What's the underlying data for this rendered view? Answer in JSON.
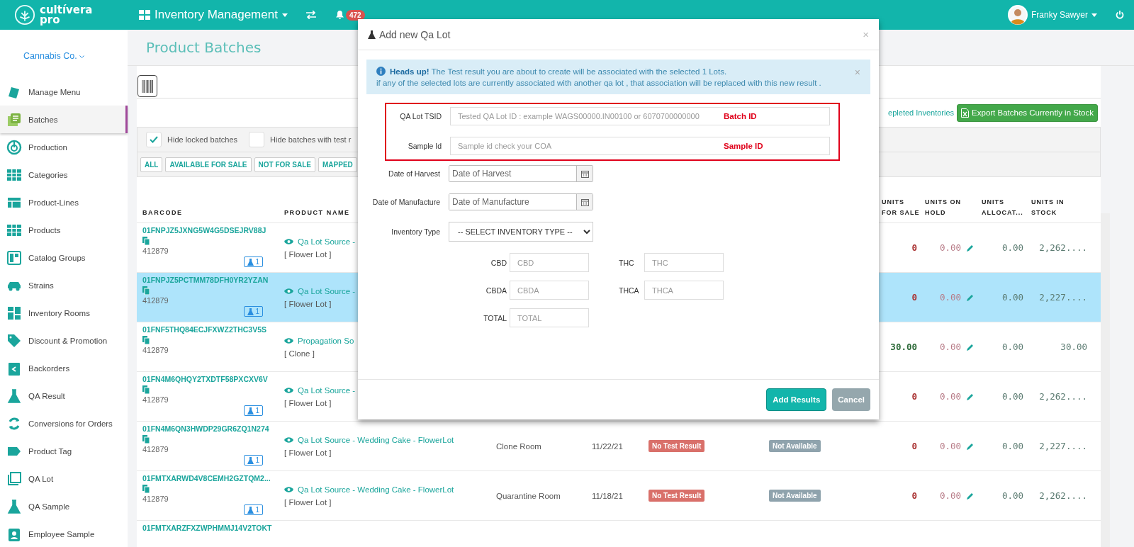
{
  "header": {
    "logo": {
      "line_1": "cultívera",
      "line_2": "pro"
    },
    "module": "Inventory Management",
    "notifications": "472",
    "user": "Franky Sawyer"
  },
  "sidebar": {
    "company": "Cannabis Co.",
    "items": [
      {
        "label": "Manage Menu",
        "selected": false
      },
      {
        "label": "Batches",
        "selected": true
      },
      {
        "label": "Production",
        "selected": false
      },
      {
        "label": "Categories",
        "selected": false
      },
      {
        "label": "Product-Lines",
        "selected": false
      },
      {
        "label": "Products",
        "selected": false
      },
      {
        "label": "Catalog Groups",
        "selected": false
      },
      {
        "label": "Strains",
        "selected": false
      },
      {
        "label": "Inventory Rooms",
        "selected": false
      },
      {
        "label": "Discount & Promotion",
        "selected": false
      },
      {
        "label": "Backorders",
        "selected": false
      },
      {
        "label": "QA Result",
        "selected": false
      },
      {
        "label": "Conversions for Orders",
        "selected": false
      },
      {
        "label": "Product Tag",
        "selected": false
      },
      {
        "label": "QA Lot",
        "selected": false
      },
      {
        "label": "QA Sample",
        "selected": false
      },
      {
        "label": "Employee Sample",
        "selected": false
      }
    ]
  },
  "page": {
    "title": "Product Batches"
  },
  "toolbar": {
    "depleted_link": "epleted Inventories",
    "export_button": "Export Batches Currently in Stock",
    "checks": [
      {
        "label": "Hide locked batches",
        "checked": true
      },
      {
        "label": "Hide batches with test r",
        "checked": false
      }
    ],
    "filters": [
      "ALL",
      "AVAILABLE FOR SALE",
      "NOT FOR SALE",
      "MAPPED"
    ]
  },
  "table": {
    "headers": {
      "barcode": "BARCODE",
      "product_name": "PRODUCT NAME",
      "units_for_sale": "UNITS FOR SALE",
      "units_on_hold": "UNITS ON HOLD",
      "units_allocated": "UNITS ALLOCAT...",
      "units_in_stock": "UNITS IN STOCK"
    },
    "rows": [
      {
        "barcode": "01FNPJZ5JXNG5W4G5DSEJRV88J",
        "number": "412879",
        "qa_count": "1",
        "product": "Qa Lot Source -",
        "type": "[ Flower Lot ]",
        "for_sale": "0",
        "available": false,
        "on_hold": "0.00",
        "allocated": "0.00",
        "in_stock": "2,262....",
        "selected": false
      },
      {
        "barcode": "01FNPJZ5PCTMM78DFH0YR2YZAN",
        "number": "412879",
        "qa_count": "1",
        "product": "Qa Lot Source -",
        "type": "[ Flower Lot ]",
        "for_sale": "0",
        "available": false,
        "on_hold": "0.00",
        "allocated": "0.00",
        "in_stock": "2,227....",
        "selected": true
      },
      {
        "barcode": "01FNF5THQ84ECJFXWZ2THC3V5S",
        "number": "412879",
        "product": "Propagation So",
        "type": "[ Clone ]",
        "for_sale": "30.00",
        "available": true,
        "on_hold": "0.00",
        "allocated": "0.00",
        "in_stock": "30.00",
        "selected": false
      },
      {
        "barcode": "01FN4M6QHQY2TXDTF58PXCXV6V",
        "number": "412879",
        "qa_count": "1",
        "product": "Qa Lot Source -",
        "type": "[ Flower Lot ]",
        "for_sale": "0",
        "available": false,
        "on_hold": "0.00",
        "allocated": "0.00",
        "in_stock": "2,262....",
        "selected": false
      },
      {
        "barcode": "01FN4M6QN3HWDP29GR6ZQ1N274",
        "number": "412879",
        "qa_count": "1",
        "product": "Qa Lot Source - Wedding Cake - FlowerLot",
        "type": "[ Flower Lot ]",
        "room": "Clone Room",
        "date": "11/22/21",
        "test_result": "No Test Result",
        "availability": "Not Available",
        "for_sale": "0",
        "available": false,
        "on_hold": "0.00",
        "allocated": "0.00",
        "in_stock": "2,227....",
        "selected": false
      },
      {
        "barcode": "01FMTXARWD4V8CEMH2GZTQM2...",
        "number": "412879",
        "qa_count": "1",
        "product": "Qa Lot Source - Wedding Cake - FlowerLot",
        "type": "[ Flower Lot ]",
        "room": "Quarantine Room",
        "date": "11/18/21",
        "test_result": "No Test Result",
        "availability": "Not Available",
        "for_sale": "0",
        "available": false,
        "on_hold": "0.00",
        "allocated": "0.00",
        "in_stock": "2,262....",
        "selected": false
      },
      {
        "barcode": "01FMTXARZFXZWPHMMJ14V2TOKT",
        "selected": false
      }
    ]
  },
  "modal": {
    "title": "Add new Qa Lot",
    "close": "×",
    "alert_close": "×",
    "alert": [
      "**Heads up!** The Test result you are about to create will be associated with the selected 1 Lots.",
      "if any of the selected lots are currently associated with another qa lot , that association will be replaced with this new result ."
    ],
    "id_fields": [
      {
        "label": "QA Lot TSID",
        "placeholder": "Tested QA Lot ID : example WAGS00000.IN00100 or 6070700000000",
        "annotation": "Batch ID"
      },
      {
        "label": "Sample Id",
        "placeholder": "Sample id check your COA",
        "annotation": "Sample ID"
      }
    ],
    "date_fields": [
      {
        "label": "Date of Harvest",
        "placeholder": "Date of Harvest"
      },
      {
        "label": "Date of Manufacture",
        "placeholder": "Date of Manufacture"
      }
    ],
    "inventory_type": {
      "label": "Inventory Type",
      "value": "-- SELECT INVENTORY TYPE --"
    },
    "potency_fields": [
      {
        "label": "CBD",
        "placeholder": "CBD"
      },
      {
        "label": "THC",
        "placeholder": "THC"
      },
      {
        "label": "CBDA",
        "placeholder": "CBDA"
      },
      {
        "label": "THCA",
        "placeholder": "THCA"
      },
      {
        "label": "TOTAL",
        "placeholder": "TOTAL"
      }
    ],
    "buttons": {
      "primary": "Add Results",
      "secondary": "Cancel"
    }
  }
}
